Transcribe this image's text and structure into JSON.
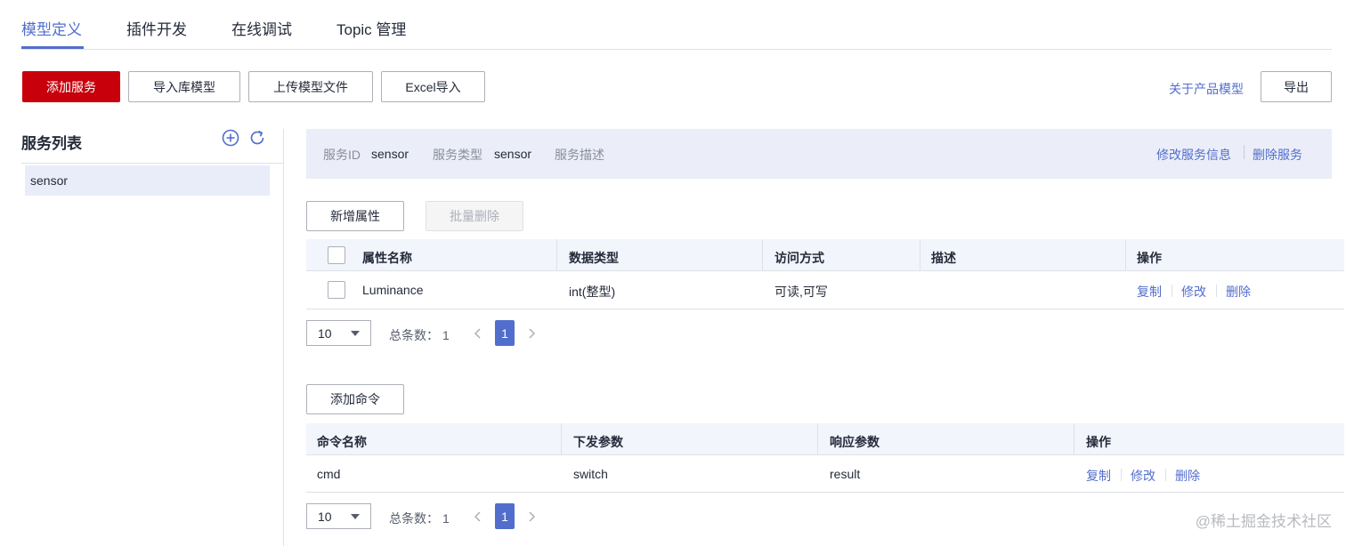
{
  "tabs": [
    {
      "label": "模型定义",
      "active": true
    },
    {
      "label": "插件开发",
      "active": false
    },
    {
      "label": "在线调试",
      "active": false
    },
    {
      "label": "Topic 管理",
      "active": false
    }
  ],
  "toolbar": {
    "add_service": "添加服务",
    "import_library_model": "导入库模型",
    "upload_model_file": "上传模型文件",
    "excel_import": "Excel导入",
    "about_product_model": "关于产品模型",
    "export": "导出"
  },
  "sidebar": {
    "title": "服务列表",
    "add_icon": "plus-circle-icon",
    "refresh_icon": "refresh-icon",
    "items": [
      {
        "label": "sensor",
        "selected": true
      }
    ]
  },
  "service_info": {
    "id_label": "服务ID",
    "id_value": "sensor",
    "type_label": "服务类型",
    "type_value": "sensor",
    "desc_label": "服务描述",
    "desc_value": "",
    "edit_link": "修改服务信息",
    "delete_link": "删除服务"
  },
  "properties": {
    "add_button": "新增属性",
    "batch_delete_button": "批量删除",
    "columns": [
      "属性名称",
      "数据类型",
      "访问方式",
      "描述",
      "操作"
    ],
    "rows": [
      {
        "name": "Luminance",
        "data_type": "int(整型)",
        "access": "可读,可写",
        "description": "",
        "actions": [
          "复制",
          "修改",
          "删除"
        ]
      }
    ],
    "pagination": {
      "page_size": "10",
      "total_label": "总条数：",
      "total": "1",
      "current_page": "1"
    }
  },
  "commands": {
    "add_button": "添加命令",
    "columns": [
      "命令名称",
      "下发参数",
      "响应参数",
      "操作"
    ],
    "rows": [
      {
        "name": "cmd",
        "request_params": "switch",
        "response_params": "result",
        "actions": [
          "复制",
          "修改",
          "删除"
        ]
      }
    ],
    "pagination": {
      "page_size": "10",
      "total_label": "总条数：",
      "total": "1",
      "current_page": "1"
    }
  },
  "colors": {
    "accent": "#526ecc",
    "primary": "#c7000b",
    "info_bg": "#ebeef8",
    "selected_bg": "#e9edfa"
  },
  "watermark": "@稀土掘金技术社区"
}
